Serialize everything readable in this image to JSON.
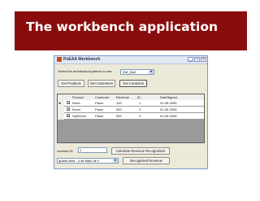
{
  "slide": {
    "title": "The workbench application",
    "banner_color": "#8a0d0d"
  },
  "window": {
    "title": "PoEAA Workbench",
    "minimize_label": "_",
    "maximize_label": "□",
    "close_label": "×",
    "pattern_label": "Select the architectural pattern to use:",
    "pattern_value": "DM_Ddd",
    "dropdown_arrow": "▼",
    "buttons": {
      "get_products": "Get Products",
      "get_customers": "Get Customers",
      "get_contracts": "Get Contracts"
    },
    "grid": {
      "columns": [
        "Product",
        "Customer",
        "Revenue",
        "ID",
        "DateSigned"
      ],
      "current_row_marker": "►",
      "expand_symbol": "+",
      "rows": [
        {
          "product": "Word",
          "customer": "Paulo",
          "revenue": "100",
          "id": "1",
          "date": "01-05-2005"
        },
        {
          "product": "Excel",
          "customer": "Paulo",
          "revenue": "300",
          "id": "2",
          "date": "01-05-2005"
        },
        {
          "product": "SqlServer",
          "customer": "Paulo",
          "revenue": "500",
          "id": "3",
          "date": "01-05-2005"
        }
      ]
    },
    "contract_id_label": "contract ID:",
    "contract_id_value": "1",
    "calc_button": "Calculate Revenue Recognitions",
    "date_value": "quarta-feira ,  3 de   Maio   de 2",
    "date_arrow": "▼",
    "recognized_button": "Recognized Revenue"
  }
}
